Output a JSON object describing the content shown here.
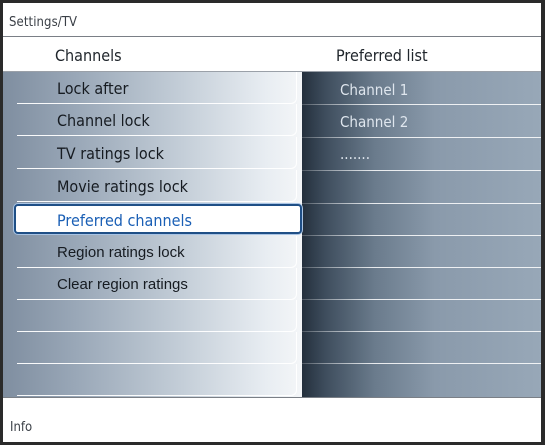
{
  "breadcrumb": "Settings/TV",
  "header": {
    "left_title": "Channels",
    "right_title": "Preferred list"
  },
  "menu": {
    "items": [
      {
        "label": "Lock after"
      },
      {
        "label": "Channel lock"
      },
      {
        "label": "TV ratings lock"
      },
      {
        "label": "Movie ratings lock"
      },
      {
        "label": "Preferred channels",
        "selected": true
      },
      {
        "label": "Region ratings lock"
      },
      {
        "label": "Clear region ratings"
      },
      {
        "label": ""
      },
      {
        "label": ""
      },
      {
        "label": ""
      }
    ]
  },
  "preferred_list": {
    "items": [
      {
        "label": "Channel 1"
      },
      {
        "label": "Channel 2"
      },
      {
        "label": "......."
      }
    ]
  },
  "info": "Info",
  "colors": {
    "selection_border": "#1f4f86",
    "selection_text": "#1a5fb5"
  }
}
